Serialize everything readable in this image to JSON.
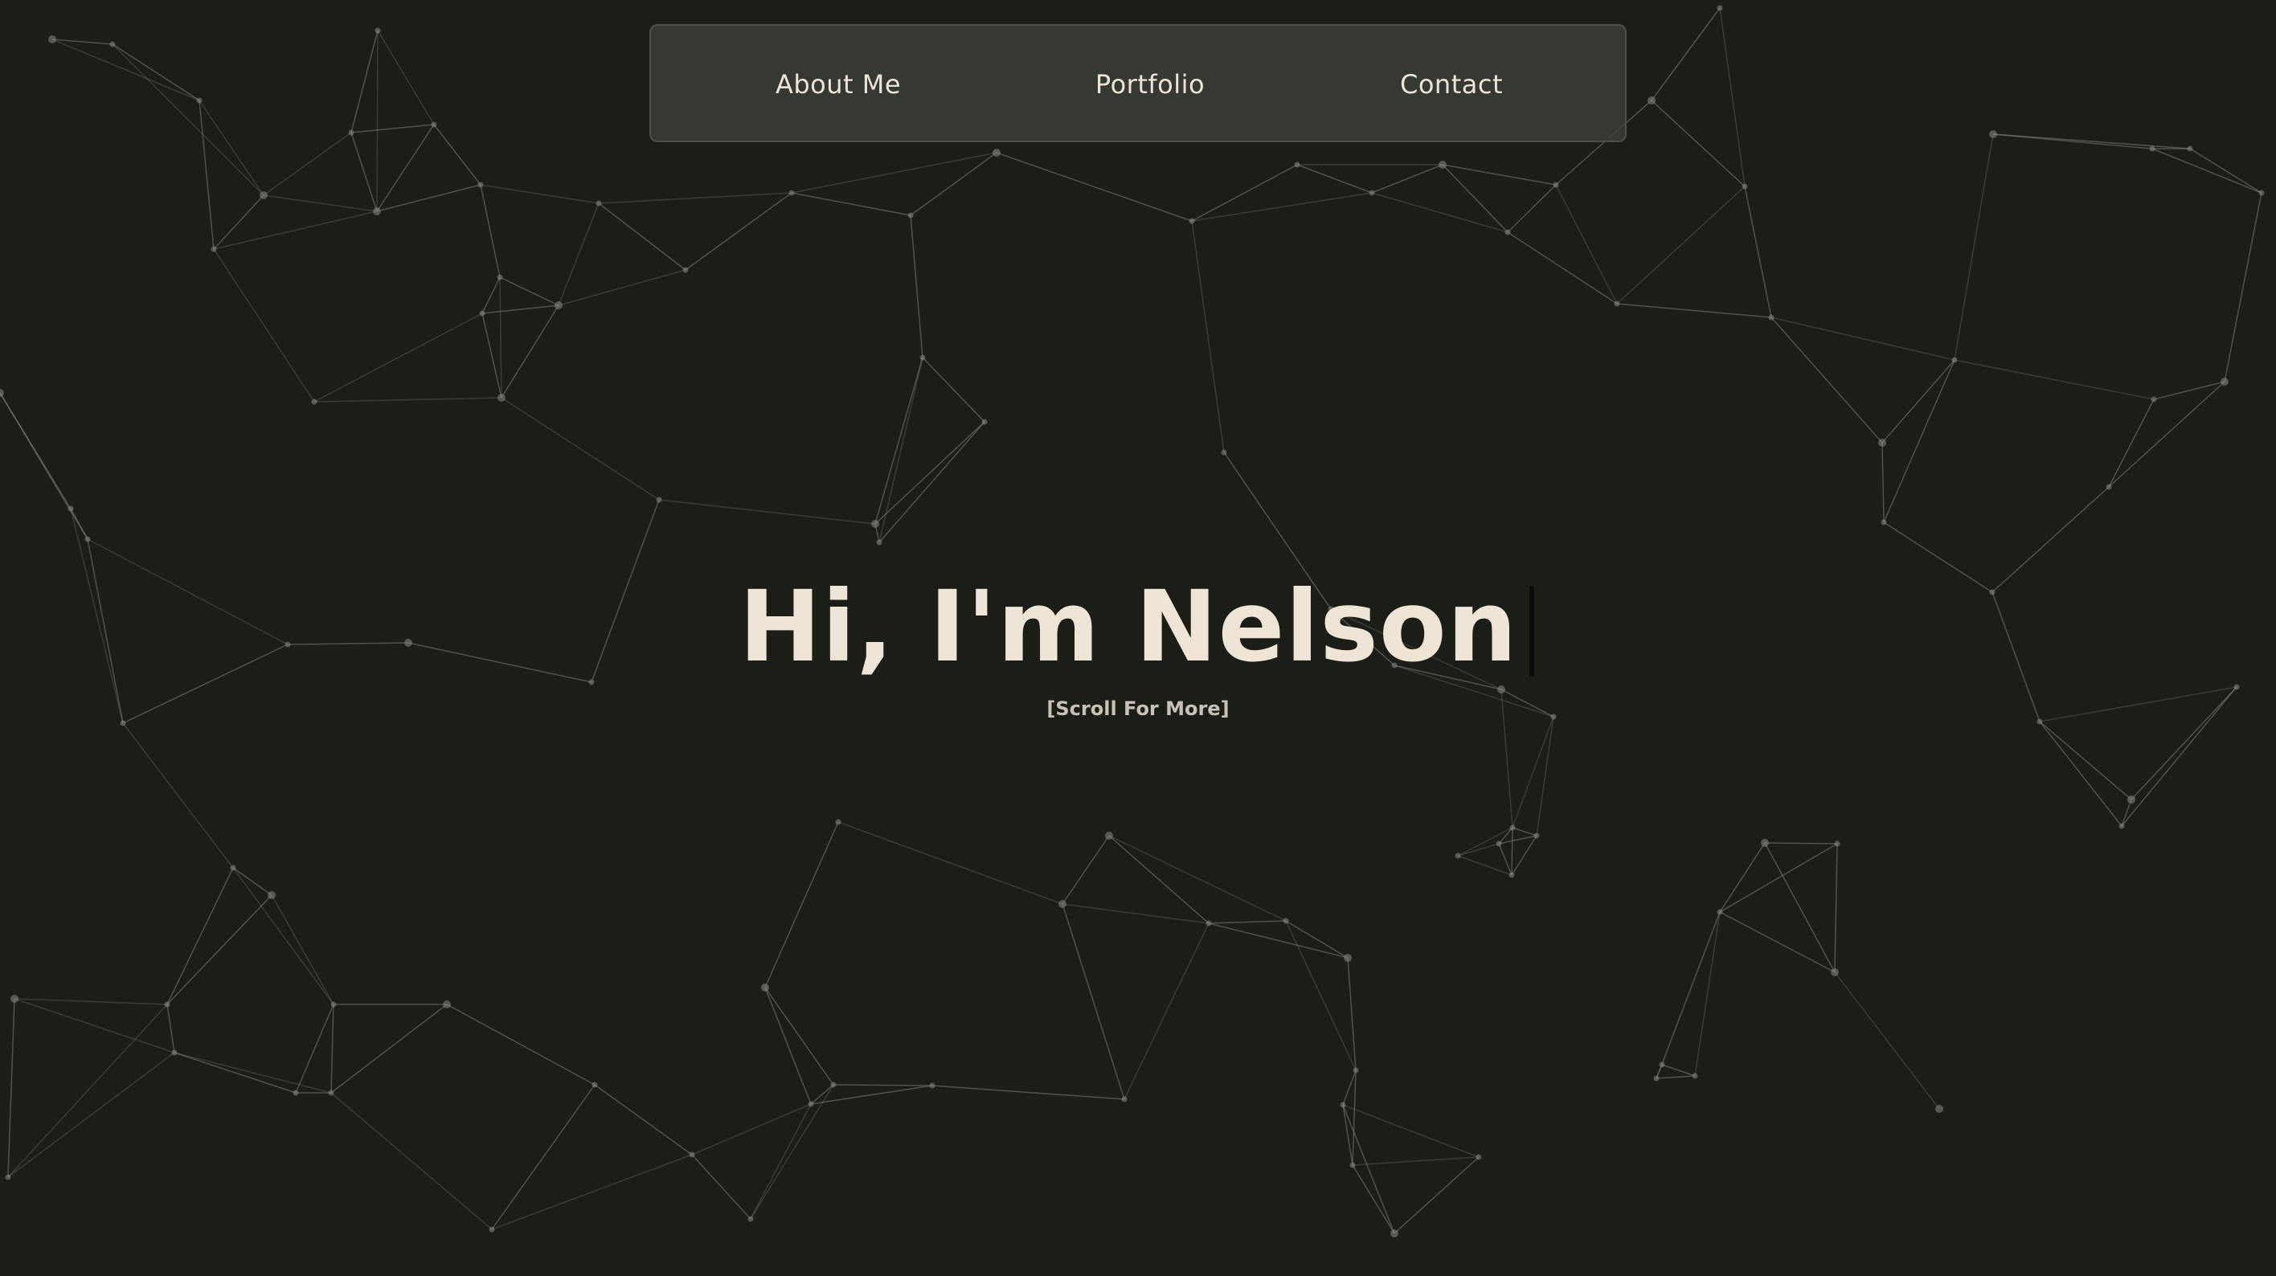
{
  "background": {
    "color": "#1b1d17",
    "pattern": "network-lines",
    "line_color": "#8a8c84"
  },
  "nav": {
    "items": [
      {
        "label": "About Me"
      },
      {
        "label": "Portfolio"
      },
      {
        "label": "Contact"
      }
    ]
  },
  "hero": {
    "title": "Hi, I'm Nelson",
    "subtitle": "[Scroll For More]",
    "text_color": "#efe5d7"
  }
}
